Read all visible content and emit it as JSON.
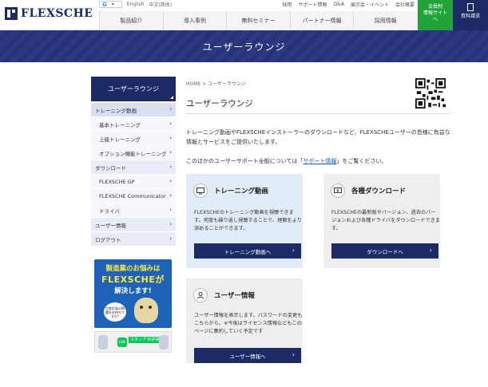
{
  "header": {
    "logo_text": "FLEXSCHE",
    "lang_google": "G",
    "lang_english": "English",
    "lang_chinese": "中文(简体)",
    "util_links": [
      "採用",
      "サポート情報",
      "Q&A",
      "展示会・イベント",
      "会社概要"
    ],
    "nav": [
      "製品紹介",
      "導入事例",
      "無料セミナー",
      "パートナー情報",
      "採用情報"
    ],
    "green_button_lines": [
      "会員制",
      "情報サイト",
      "へ"
    ],
    "navy_button_label": "資料請求"
  },
  "banner": {
    "title": "ユーザーラウンジ"
  },
  "sidebar": {
    "heading": "ユーザーラウンジ",
    "items": [
      {
        "label": "トレーニング動画",
        "sub": false,
        "active": true
      },
      {
        "label": "基本トレーニング",
        "sub": true
      },
      {
        "label": "上級トレーニング",
        "sub": true
      },
      {
        "label": "オプション機能トレーニング",
        "sub": true
      },
      {
        "label": "ダウンロード",
        "sub": false
      },
      {
        "label": "FLEXSCHE GP",
        "sub": true
      },
      {
        "label": "FLEXSCHE Communicator",
        "sub": true
      },
      {
        "label": "ドライバ",
        "sub": true
      },
      {
        "label": "ユーザー情報",
        "sub": false
      },
      {
        "label": "ログアウト",
        "sub": false
      }
    ],
    "promo_line1": "製造業のお悩みは",
    "promo_line2": "FLEXSCHEが",
    "promo_line3": "解決します!",
    "promo_bubble": "生産計画の問題をお持ちですか?",
    "line_logo": "LINE",
    "line_tag": "スタンプ 好評発売中"
  },
  "main": {
    "breadcrumb": "HOME > ユーザーラウンジ",
    "title": "ユーザーラウンジ",
    "intro": "トレーニング動画やFLEXSCHEインストーラーのダウンロードなど、FLEXSCHEユーザーの皆様に有益な情報とサービスをご提供いたします。",
    "intro2_prefix": "このほかのユーザーサポート全般については「",
    "intro2_link": "サポート情報",
    "intro2_suffix": "」をご覧ください。",
    "cards": [
      {
        "title": "トレーニング動画",
        "body": "FLEXSCHEのトレーニング動画を視聴できます。何度も繰り返し視聴することで、理解をより深めることができます。",
        "button": "トレーニング動画へ"
      },
      {
        "title": "各種ダウンロード",
        "body": "FLEXSCHEの最新版やバージョン、過去のバージョンおよび各種ドライバをダウンロードできます。",
        "button": "ダウンロードへ"
      },
      {
        "title": "ユーザー情報",
        "body": "ユーザー情報を表示します。パスワードの変更もこちらから。※今後はライセンス情報などもこのページに集約していく予定です",
        "button": "ユーザー情報へ"
      }
    ]
  },
  "colors": {
    "navy": "#1c2a66",
    "banner": "#26327a",
    "green": "#21a33a",
    "card_blue": "#e1ecf8",
    "card_gray": "#eeeeee",
    "link": "#1d5fbf"
  }
}
